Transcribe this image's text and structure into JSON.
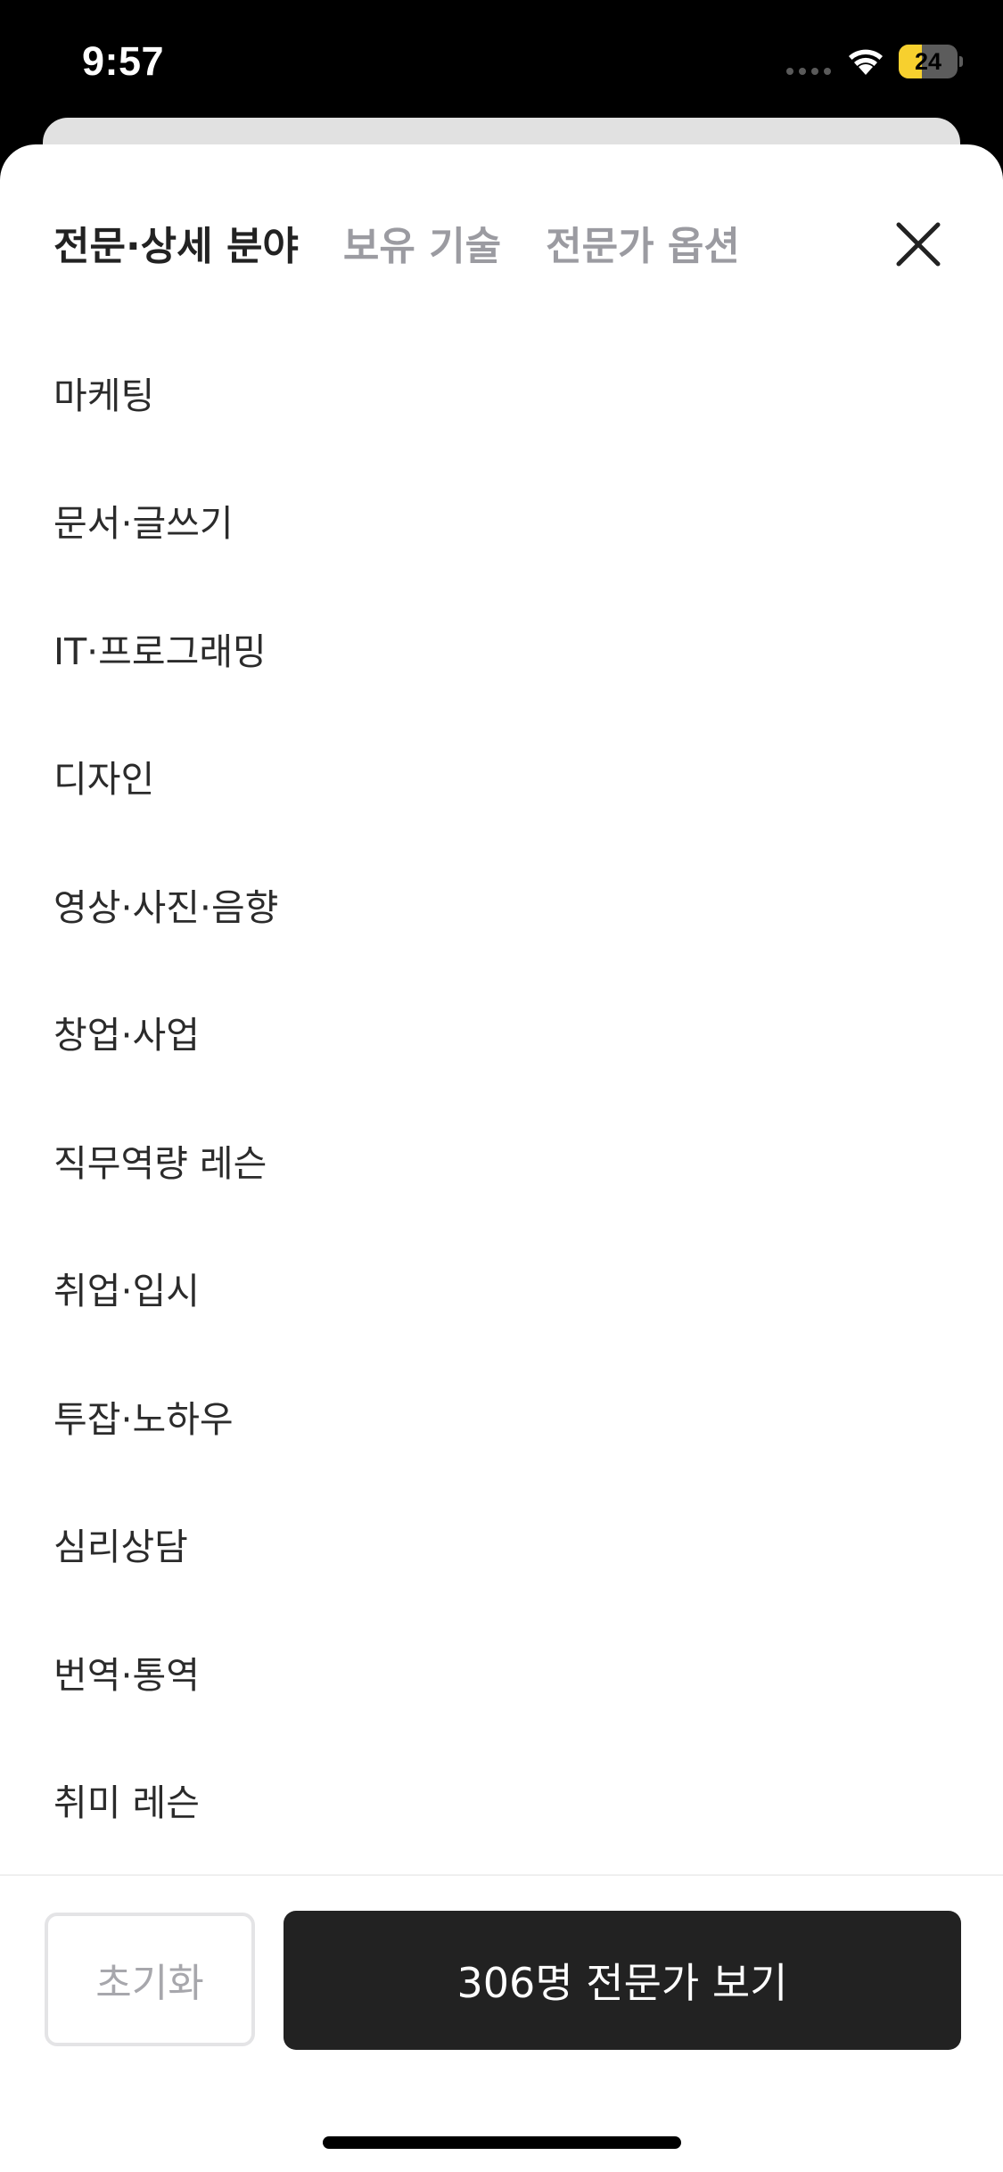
{
  "status_bar": {
    "time": "9:57",
    "battery_level": "24",
    "battery_fraction": 0.24,
    "icons": [
      "signal-dots",
      "wifi-icon",
      "battery-charging-icon"
    ]
  },
  "tabs": [
    {
      "label": "전문·상세 분야",
      "active": true
    },
    {
      "label": "보유 기술",
      "active": false
    },
    {
      "label": "전문가 옵션",
      "active": false
    }
  ],
  "close_icon": "close-icon",
  "categories": [
    "마케팅",
    "문서·글쓰기",
    "IT·프로그래밍",
    "디자인",
    "영상·사진·음향",
    "창업·사업",
    "직무역량 레슨",
    "취업·입시",
    "투잡·노하우",
    "심리상담",
    "번역·통역",
    "취미 레슨"
  ],
  "footer": {
    "reset_label": "초기화",
    "view_label": "306명 전문가 보기"
  },
  "colors": {
    "primary_button": "#222222",
    "inactive_tab": "#9b9ba1",
    "battery_accent": "#f7d02e"
  }
}
